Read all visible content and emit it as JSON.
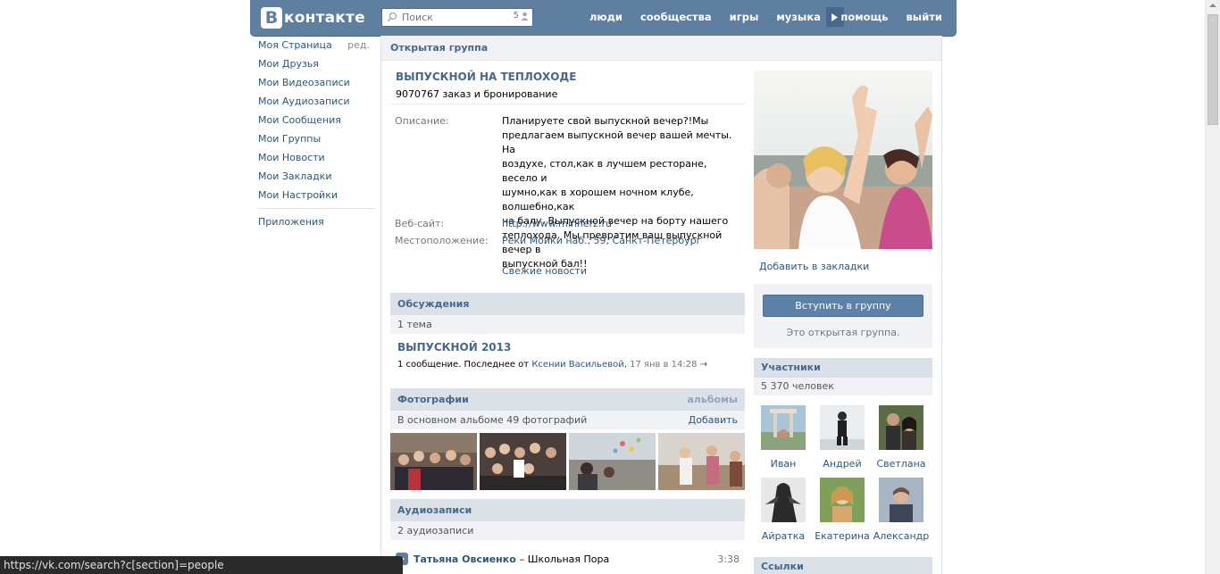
{
  "header": {
    "logo_letter": "В",
    "logo_text": "контакте",
    "search_placeholder": "Поиск",
    "search_count": "5",
    "nav": [
      "люди",
      "сообщества",
      "игры",
      "музыка"
    ],
    "nav_right": [
      "помощь",
      "выйти"
    ],
    "colors": {
      "header": "#5f7fa1",
      "link": "#2b587a",
      "title": "#45688e"
    }
  },
  "leftmenu": {
    "items": [
      "Моя Страница",
      "Мои Друзья",
      "Мои Видеозаписи",
      "Мои Аудиозаписи",
      "Мои Сообщения",
      "Мои Группы",
      "Мои Новости",
      "Мои Закладки",
      "Мои Настройки"
    ],
    "edit": "ред.",
    "apps": "Приложения"
  },
  "page": {
    "topbar": "Открытая группа",
    "title": "ВЫПУСКНОЙ НА ТЕПЛОХОДЕ",
    "status": "9070767 заказ и бронирование",
    "desc_label": "Описание:",
    "desc_lines": [
      "Планируете свой выпускной вечер?!Мы",
      "предлагаем выпускной вечер вашей мечты. На",
      "воздухе, стол,как в лучшем ресторане, весело и",
      "шумно,как в хорошем ночном клубе, волшебно,как",
      "на балу. Выпускной вечер на борту нашего",
      "теплохода. Мы превратим ваш выпускной вечер в",
      "выпускной бал!!"
    ],
    "website_label": "Веб-сайт:",
    "website": "http://www.minherz.ru",
    "location_label": "Местоположение:",
    "location": "Реки Мойки наб., 59, Санкт-Петербург",
    "news_link": "Свежие новости"
  },
  "discussions": {
    "title": "Обсуждения",
    "count": "1 тема",
    "topic_title": "ВЫПУСКНОЙ 2013",
    "topic_meta_prefix": "1 сообщение. Последнее от",
    "topic_author": "Ксении Васильевой,",
    "topic_date": "17 янв в 14:28",
    "topic_arrow": "→"
  },
  "photos": {
    "title": "Фотографии",
    "albums": "альбомы",
    "count": "В основном альбоме 49 фотографий",
    "add": "Добавить"
  },
  "audio": {
    "title": "Аудиозаписи",
    "count": "2 аудиозаписи",
    "tracks": [
      {
        "artist": "Татьяна Овсиенко",
        "title": "– Школьная Пора",
        "duration": "3:38"
      }
    ]
  },
  "side": {
    "bookmark": "Добавить в закладки",
    "join": "Вступить в группу",
    "join_note": "Это открытая группа.",
    "members_title": "Участники",
    "members_count": "5 370 человек",
    "members": [
      "Иван",
      "Андрей",
      "Светлана",
      "Айратка",
      "Екатерина",
      "Александр"
    ],
    "links_title": "Ссылки"
  },
  "statusbar": "https://vk.com/search?c[section]=people"
}
